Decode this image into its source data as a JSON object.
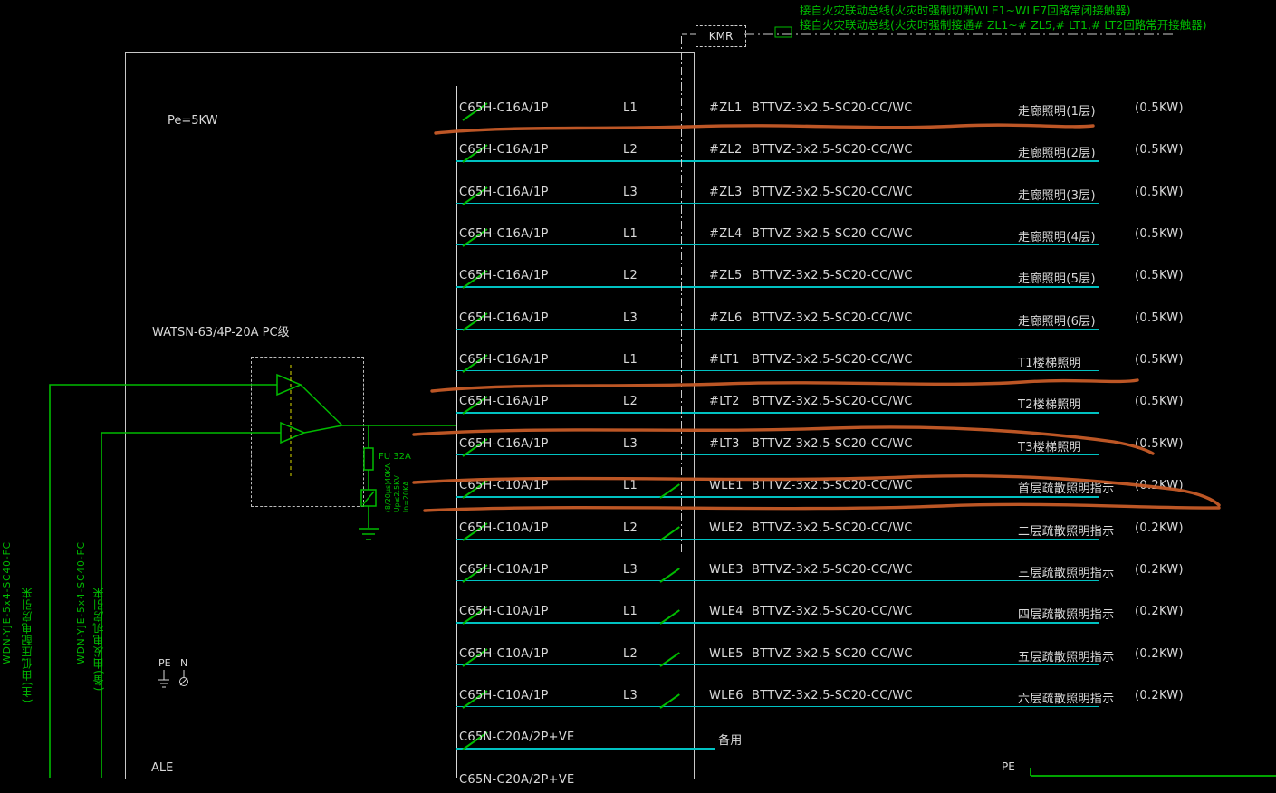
{
  "colors": {
    "background": "#000000",
    "wire_cyan": "#00c2c2",
    "device_green": "#00bb00",
    "text_white": "#d9d9d9",
    "marker_orange": "#c75b28",
    "link_yellow": "#b8b800"
  },
  "fire_linkage": {
    "note1": "接自火灾联动总线(火灾时强制切断WLE1~WLE7回路常闭接触器)",
    "note2": "接自火灾联动总线(火灾时强制接通# ZL1~# ZL5,# LT1,# LT2回路常开接触器)",
    "kmr_label": "KMR"
  },
  "panel_labels": {
    "capacity": "Pe=5KW",
    "ats_type": "WATSN-63/4P-20A PC级",
    "fuse": "FU 32A",
    "spd_specs": [
      "(8/20μs)40KA",
      "Up≤2.5KV",
      "In=20KA"
    ],
    "pe": "PE",
    "n": "N",
    "panel_name": "ALE",
    "bottom_pe": "PE"
  },
  "incoming": [
    {
      "cable": "WDN-YJE-5x4-SC40-FC",
      "desc": "(主)由低压配电房引来"
    },
    {
      "cable": "WDN-YJE-5x4-SC40-FC",
      "desc": "(备)由发电机房引来"
    }
  ],
  "circuits": [
    {
      "type": "normal",
      "breaker": "C65H-C16A/1P",
      "phase": "L1",
      "id": "#ZL1",
      "cable": "BTTVZ-3x2.5-SC20-CC/WC",
      "load": "走廊照明(1层)",
      "power": "(0.5KW)",
      "contactor": false
    },
    {
      "type": "normal",
      "breaker": "C65H-C16A/1P",
      "phase": "L2",
      "id": "#ZL2",
      "cable": "BTTVZ-3x2.5-SC20-CC/WC",
      "load": "走廊照明(2层)",
      "power": "(0.5KW)",
      "contactor": false
    },
    {
      "type": "normal",
      "breaker": "C65H-C16A/1P",
      "phase": "L3",
      "id": "#ZL3",
      "cable": "BTTVZ-3x2.5-SC20-CC/WC",
      "load": "走廊照明(3层)",
      "power": "(0.5KW)",
      "contactor": false
    },
    {
      "type": "normal",
      "breaker": "C65H-C16A/1P",
      "phase": "L1",
      "id": "#ZL4",
      "cable": "BTTVZ-3x2.5-SC20-CC/WC",
      "load": "走廊照明(4层)",
      "power": "(0.5KW)",
      "contactor": false
    },
    {
      "type": "normal",
      "breaker": "C65H-C16A/1P",
      "phase": "L2",
      "id": "#ZL5",
      "cable": "BTTVZ-3x2.5-SC20-CC/WC",
      "load": "走廊照明(5层)",
      "power": "(0.5KW)",
      "contactor": false
    },
    {
      "type": "normal",
      "breaker": "C65H-C16A/1P",
      "phase": "L3",
      "id": "#ZL6",
      "cable": "BTTVZ-3x2.5-SC20-CC/WC",
      "load": "走廊照明(6层)",
      "power": "(0.5KW)",
      "contactor": false
    },
    {
      "type": "normal",
      "breaker": "C65H-C16A/1P",
      "phase": "L1",
      "id": "#LT1",
      "cable": "BTTVZ-3x2.5-SC20-CC/WC",
      "load": "T1楼梯照明",
      "power": "(0.5KW)",
      "contactor": false
    },
    {
      "type": "normal",
      "breaker": "C65H-C16A/1P",
      "phase": "L2",
      "id": "#LT2",
      "cable": "BTTVZ-3x2.5-SC20-CC/WC",
      "load": "T2楼梯照明",
      "power": "(0.5KW)",
      "contactor": false
    },
    {
      "type": "normal",
      "breaker": "C65H-C16A/1P",
      "phase": "L3",
      "id": "#LT3",
      "cable": "BTTVZ-3x2.5-SC20-CC/WC",
      "load": "T3楼梯照明",
      "power": "(0.5KW)",
      "contactor": false
    },
    {
      "type": "normal",
      "breaker": "C65H-C10A/1P",
      "phase": "L1",
      "id": "WLE1",
      "cable": "BTTVZ-3x2.5-SC20-CC/WC",
      "load": "首层疏散照明指示",
      "power": "(0.2KW)",
      "contactor": true
    },
    {
      "type": "normal",
      "breaker": "C65H-C10A/1P",
      "phase": "L2",
      "id": "WLE2",
      "cable": "BTTVZ-3x2.5-SC20-CC/WC",
      "load": "二层疏散照明指示",
      "power": "(0.2KW)",
      "contactor": true
    },
    {
      "type": "normal",
      "breaker": "C65H-C10A/1P",
      "phase": "L3",
      "id": "WLE3",
      "cable": "BTTVZ-3x2.5-SC20-CC/WC",
      "load": "三层疏散照明指示",
      "power": "(0.2KW)",
      "contactor": true
    },
    {
      "type": "normal",
      "breaker": "C65H-C10A/1P",
      "phase": "L1",
      "id": "WLE4",
      "cable": "BTTVZ-3x2.5-SC20-CC/WC",
      "load": "四层疏散照明指示",
      "power": "(0.2KW)",
      "contactor": true
    },
    {
      "type": "normal",
      "breaker": "C65H-C10A/1P",
      "phase": "L2",
      "id": "WLE5",
      "cable": "BTTVZ-3x2.5-SC20-CC/WC",
      "load": "五层疏散照明指示",
      "power": "(0.2KW)",
      "contactor": true
    },
    {
      "type": "normal",
      "breaker": "C65H-C10A/1P",
      "phase": "L3",
      "id": "WLE6",
      "cable": "BTTVZ-3x2.5-SC20-CC/WC",
      "load": "六层疏散照明指示",
      "power": "(0.2KW)",
      "contactor": true
    },
    {
      "type": "spare",
      "breaker": "C65N-C20A/2P+VE",
      "phase": "",
      "id": "",
      "cable": "",
      "load": "备用",
      "power": "",
      "contactor": false
    },
    {
      "type": "partial",
      "breaker": "C65N-C20A/2P+VE",
      "phase": "",
      "id": "",
      "cable": "",
      "load": "",
      "power": "",
      "contactor": false
    }
  ]
}
